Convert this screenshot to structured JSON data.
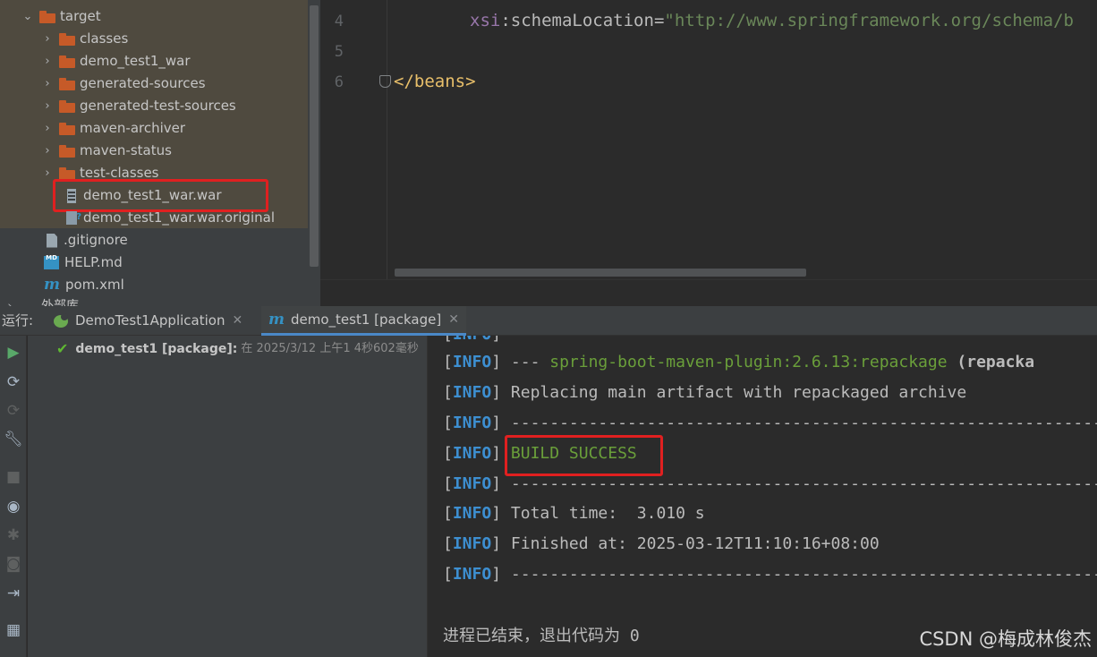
{
  "project_tree": {
    "root": {
      "label": "target",
      "expanded": true
    },
    "items": [
      {
        "label": "classes",
        "type": "folder"
      },
      {
        "label": "demo_test1_war",
        "type": "folder"
      },
      {
        "label": "generated-sources",
        "type": "folder"
      },
      {
        "label": "generated-test-sources",
        "type": "folder"
      },
      {
        "label": "maven-archiver",
        "type": "folder"
      },
      {
        "label": "maven-status",
        "type": "folder"
      },
      {
        "label": "test-classes",
        "type": "folder"
      },
      {
        "label": "demo_test1_war.war",
        "type": "war-file",
        "highlighted": true
      },
      {
        "label": "demo_test1_war.war.original",
        "type": "file"
      }
    ],
    "root_files": [
      {
        "label": ".gitignore",
        "icon": "gitignore-icon"
      },
      {
        "label": "HELP.md",
        "icon": "markdown-icon"
      },
      {
        "label": "pom.xml",
        "icon": "maven-icon"
      }
    ],
    "cut_off_label": "外部库"
  },
  "editor": {
    "lines": [
      {
        "number": "4",
        "ns": "xsi",
        "sep": ":",
        "attr": "schemaLocation",
        "eq": "=",
        "value": "\"http://www.springframework.org/schema/b"
      },
      {
        "number": "5"
      },
      {
        "number": "6",
        "tag": "</beans>"
      }
    ]
  },
  "run_bar": {
    "label": "运行:",
    "tabs": [
      {
        "label": "DemoTest1Application",
        "icon": "spring-boot-icon",
        "active": false
      },
      {
        "label": "demo_test1 [package]",
        "icon": "maven-icon",
        "active": true
      }
    ]
  },
  "run_tree": {
    "item": {
      "name": "demo_test1 [package]:",
      "meta": "在 2025/3/12 上午1 4秒602毫秒"
    }
  },
  "console": {
    "level": "INFO",
    "lines": [
      {
        "prefix": "--- ",
        "plugin": "spring-boot-maven-plugin:2.6.13:repackage",
        "suffix": " (repacka"
      },
      {
        "text": "Replacing main artifact with repackaged archive"
      },
      {
        "text": "------------------------------------------------------------------------"
      },
      {
        "status": "BUILD SUCCESS"
      },
      {
        "text": "------------------------------------------------------------------------"
      },
      {
        "text": "Total time:  3.010 s"
      },
      {
        "text": "Finished at: 2025-03-12T11:10:16+08:00"
      },
      {
        "text": "------------------------------------------------------------------------"
      }
    ],
    "exit_message": "进程已结束，退出代码为 0"
  },
  "watermark": "CSDN @梅成林俊杰",
  "colors": {
    "accent_red": "#e02020",
    "info_blue": "#3d8fd1",
    "success_green": "#6a9f3a",
    "folder_orange": "#c65a28"
  }
}
